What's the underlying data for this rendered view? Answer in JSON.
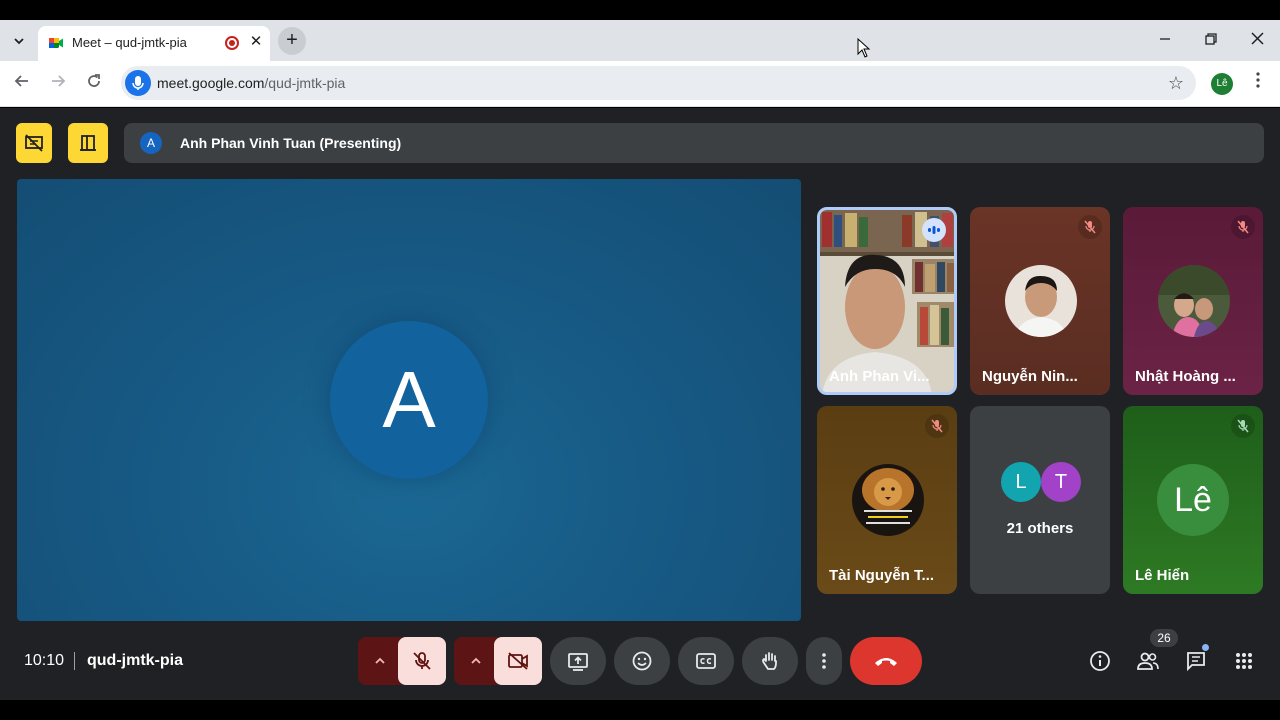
{
  "browser": {
    "tab_title": "Meet – qud-jmtk-pia",
    "url_domain": "meet.google.com",
    "url_path": "/qud-jmtk-pia",
    "profile_initials": "Lê"
  },
  "meet": {
    "presenting_initial": "A",
    "presenting_label": "Anh Phan Vinh Tuan (Presenting)",
    "main_avatar_initial": "A",
    "tiles": [
      {
        "name": "Anh Phan Vi...",
        "state": "speaking"
      },
      {
        "name": "Nguyễn Nin...",
        "state": "muted"
      },
      {
        "name": "Nhật Hoàng ...",
        "state": "muted"
      },
      {
        "name": "Tài Nguyễn T...",
        "state": "muted"
      },
      {
        "name": "21 others",
        "initials": [
          "L",
          "T"
        ]
      },
      {
        "name": "Lê Hiển",
        "initial": "Lê",
        "state": "muted"
      }
    ],
    "clock": "10:10",
    "meeting_code": "qud-jmtk-pia",
    "participants_count": "26"
  },
  "colors": {
    "tab_bar": "#dfe3e7",
    "meet_bg": "#202124",
    "accent_yellow": "#fdd835",
    "end_call_red": "#dc362e",
    "main_tile_blue": "#175b86"
  }
}
